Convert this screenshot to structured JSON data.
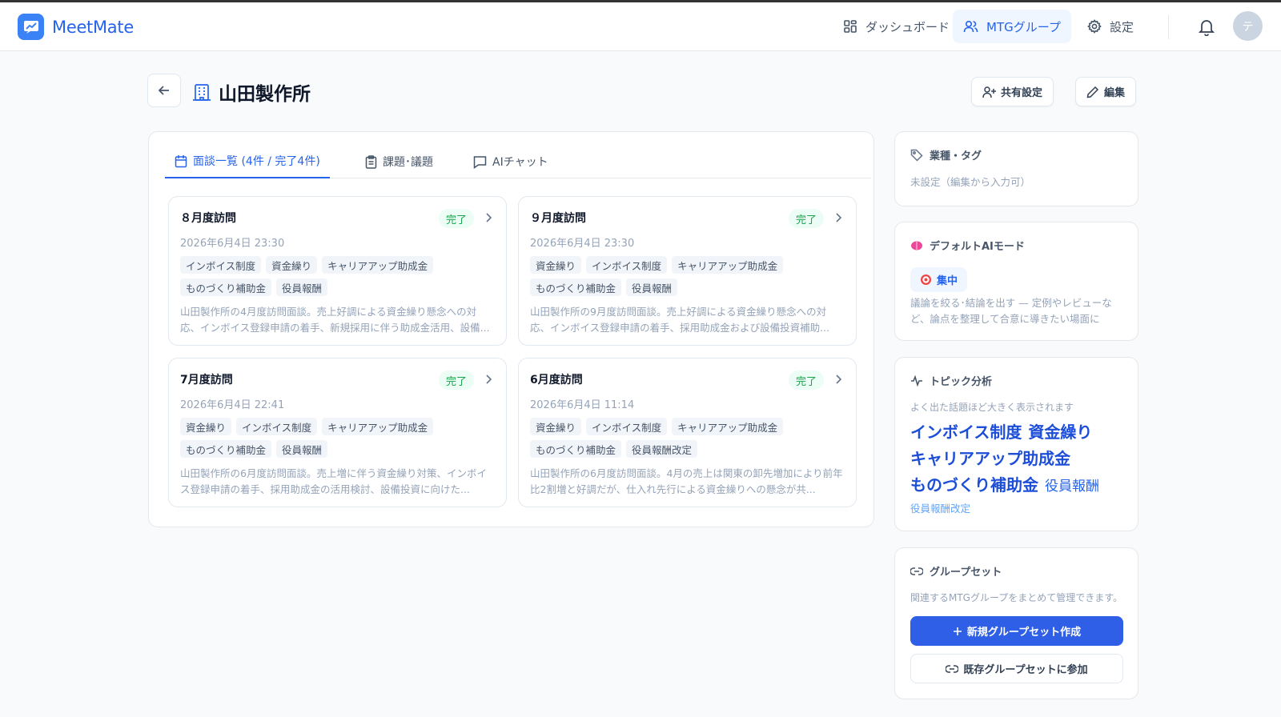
{
  "app": {
    "name": "MeetMate",
    "avatar_initial": "テ"
  },
  "nav": {
    "dashboard": "ダッシュボード",
    "groups": "MTGグループ",
    "settings": "設定"
  },
  "page": {
    "title": "山田製作所"
  },
  "actions": {
    "share": "共有設定",
    "edit": "編集"
  },
  "tabs": [
    {
      "label": "面談一覧 (4件 / 完了4件)"
    },
    {
      "label": "課題･議題"
    },
    {
      "label": "AIチャット"
    }
  ],
  "meetings": [
    {
      "title": "８月度訪問",
      "status": "完了",
      "date": "2026年6月4日 23:30",
      "tags": [
        "インボイス制度",
        "資金繰り",
        "キャリアアップ助成金",
        "ものづくり補助金",
        "役員報酬"
      ],
      "summary": "山田製作所の4月度訪問面談。売上好調による資金繰り懸念への対応、インボイス登録申請の着手、新規採用に伴う助成金活用、設備..."
    },
    {
      "title": "９月度訪問",
      "status": "完了",
      "date": "2026年6月4日 23:30",
      "tags": [
        "資金繰り",
        "インボイス制度",
        "キャリアアップ助成金",
        "ものづくり補助金",
        "役員報酬"
      ],
      "summary": "山田製作所の9月度訪問面談。売上好調による資金繰り懸念への対応、インボイス登録申請の着手、採用助成金および設備投資補助..."
    },
    {
      "title": "7月度訪問",
      "status": "完了",
      "date": "2026年6月4日 22:41",
      "tags": [
        "資金繰り",
        "インボイス制度",
        "キャリアアップ助成金",
        "ものづくり補助金",
        "役員報酬"
      ],
      "summary": "山田製作所の6月度訪問面談。売上増に伴う資金繰り対策、インボイス登録申請の着手、採用助成金の活用検討、設備投資に向けた..."
    },
    {
      "title": "6月度訪問",
      "status": "完了",
      "date": "2026年6月4日 11:14",
      "tags": [
        "資金繰り",
        "インボイス制度",
        "キャリアアップ助成金",
        "ものづくり補助金",
        "役員報酬改定"
      ],
      "summary": "山田製作所の6月度訪問面談。4月の売上は関東の卸先増加により前年比2割増と好調だが、仕入れ先行による資金繰りへの懸念が共..."
    }
  ],
  "industry": {
    "heading": "業種・タグ",
    "text": "未設定（編集から入力可）"
  },
  "ai_mode": {
    "heading": "デフォルトAIモード",
    "mode": "集中",
    "desc": "議論を絞る･結論を出す — 定例やレビューなど、論点を整理して合意に導きたい場面に"
  },
  "topics": {
    "heading": "トピック分析",
    "subtitle": "よく出た話題ほど大きく表示されます",
    "words": [
      {
        "text": "インボイス制度",
        "weight": 4
      },
      {
        "text": "資金繰り",
        "weight": 4
      },
      {
        "text": "キャリアアップ助成金",
        "weight": 4
      },
      {
        "text": "ものづくり補助金",
        "weight": 4
      },
      {
        "text": "役員報酬",
        "weight": 3
      },
      {
        "text": "役員報酬改定",
        "weight": 1
      }
    ]
  },
  "groupset": {
    "heading": "グループセット",
    "desc": "関連するMTGグループをまとめて管理できます。",
    "create": "新規グループセット作成",
    "join": "既存グループセットに参加"
  },
  "colors": {
    "accent": "#2563eb",
    "primary_button": "#2f5fe6",
    "done_badge": "#16a34a"
  }
}
